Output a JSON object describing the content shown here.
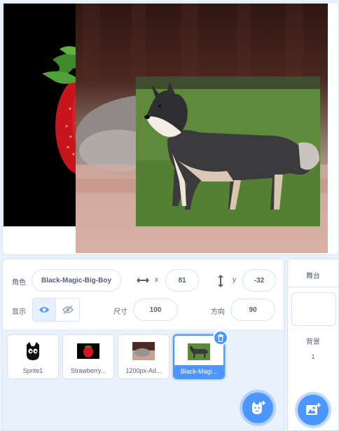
{
  "stage": {
    "sprites_shown": [
      "Strawberry",
      "Cat photo",
      "Husky dog"
    ]
  },
  "sprite_info": {
    "sprite_label": "角色",
    "sprite_name": "Black-Magic-Big-Boy",
    "x_label": "x",
    "x_value": "81",
    "y_label": "y",
    "y_value": "-32",
    "show_label": "显示",
    "size_label": "尺寸",
    "size_value": "100",
    "direction_label": "方向",
    "direction_value": "90"
  },
  "sprites": [
    {
      "name": "Sprite1",
      "selected": false
    },
    {
      "name": "Strawberry...",
      "selected": false
    },
    {
      "name": "1200px-Ad...",
      "selected": false
    },
    {
      "name": "Black-Magi...",
      "selected": true
    }
  ],
  "stage_panel": {
    "title": "舞台",
    "backdrops_label": "背景",
    "backdrops_count": "1"
  },
  "colors": {
    "accent": "#4c97ff",
    "panel_bg": "#e9f1fc",
    "border": "#d9e3f2",
    "text": "#575e75"
  },
  "icons": {
    "delete": "trash-icon",
    "add_sprite": "cat-add-icon",
    "add_backdrop": "image-add-icon"
  }
}
